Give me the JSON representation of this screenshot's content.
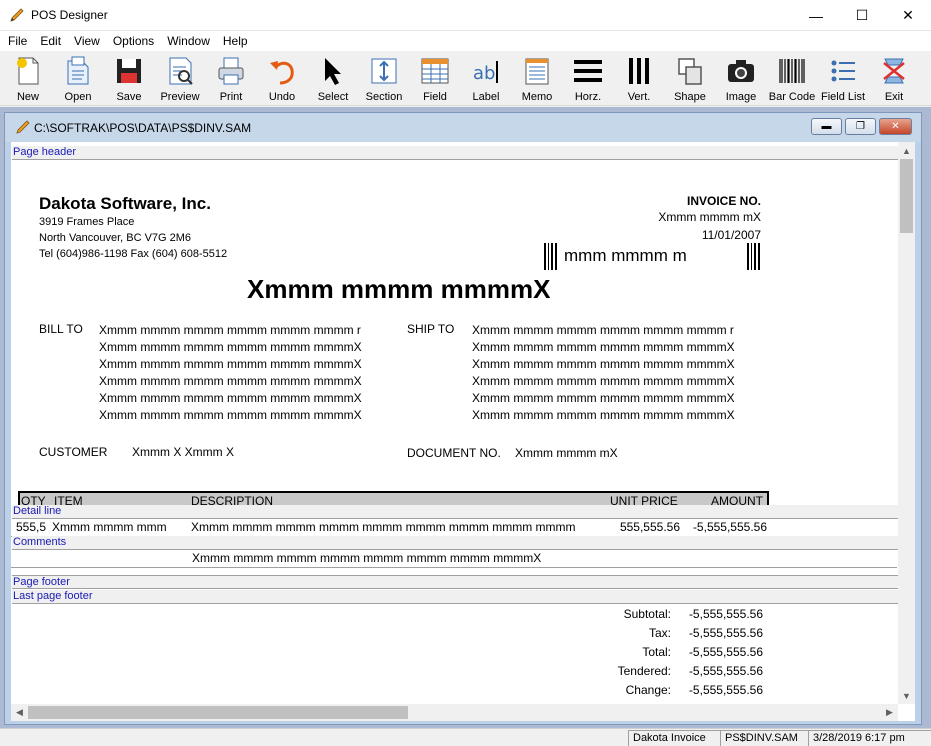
{
  "window": {
    "title": "POS Designer",
    "minimize": "—",
    "maximize": "☐",
    "close": "✕"
  },
  "menu": [
    "File",
    "Edit",
    "View",
    "Options",
    "Window",
    "Help"
  ],
  "toolbar": [
    {
      "label": "New",
      "icon": "new-document-icon"
    },
    {
      "label": "Open",
      "icon": "open-document-icon"
    },
    {
      "label": "Save",
      "icon": "floppy-disk-icon"
    },
    {
      "label": "Preview",
      "icon": "preview-icon"
    },
    {
      "label": "Print",
      "icon": "printer-icon"
    },
    {
      "label": "Undo",
      "icon": "undo-arrow-icon"
    },
    {
      "label": "Select",
      "icon": "pointer-arrow-icon"
    },
    {
      "label": "Section",
      "icon": "section-icon"
    },
    {
      "label": "Field",
      "icon": "field-grid-icon"
    },
    {
      "label": "Label",
      "icon": "label-text-icon"
    },
    {
      "label": "Memo",
      "icon": "memo-icon"
    },
    {
      "label": "Horz.",
      "icon": "horizontal-lines-icon"
    },
    {
      "label": "Vert.",
      "icon": "vertical-lines-icon"
    },
    {
      "label": "Shape",
      "icon": "shape-icon"
    },
    {
      "label": "Image",
      "icon": "camera-icon"
    },
    {
      "label": "Bar Code",
      "icon": "barcode-icon"
    },
    {
      "label": "Field List",
      "icon": "field-list-icon"
    },
    {
      "label": "Exit",
      "icon": "exit-icon"
    }
  ],
  "document": {
    "title": "C:\\SOFTRAK\\POS\\DATA\\PS$DINV.SAM",
    "bands": {
      "page_header": "Page header",
      "detail": "Detail line",
      "comments": "Comments",
      "page_footer": "Page footer",
      "last_page_footer": "Last page footer"
    },
    "company": {
      "name": "Dakota Software, Inc.",
      "address1": "3919 Frames Place",
      "address2": "North Vancouver, BC V7G 2M6",
      "phone": "Tel (604)986-1198   Fax (604) 608-5512"
    },
    "invoice_label": "INVOICE NO.",
    "invoice_no": "Xmmm mmmm mX",
    "invoice_date": "11/01/2007",
    "barcode_text": "mmm    mmmm     m",
    "big_title": "Xmmm mmmm mmmmX",
    "bill_to_label": "BILL TO",
    "ship_to_label": "SHIP TO",
    "bill_to_lines": [
      "Xmmm mmmm mmmm mmmm mmmm mmmm r",
      "Xmmm mmmm mmmm mmmm mmmm mmmmX",
      "Xmmm mmmm mmmm mmmm mmmm mmmmX",
      "Xmmm mmmm mmmm mmmm mmmm mmmmX",
      "Xmmm mmmm mmmm mmmm mmmm mmmmX",
      "Xmmm mmmm mmmm mmmm mmmm mmmmX"
    ],
    "ship_to_lines": [
      "Xmmm mmmm mmmm mmmm mmmm mmmm r",
      "Xmmm mmmm mmmm mmmm mmmm mmmmX",
      "Xmmm mmmm mmmm mmmm mmmm mmmmX",
      "Xmmm mmmm mmmm mmmm mmmm mmmmX",
      "Xmmm mmmm mmmm mmmm mmmm mmmmX",
      "Xmmm mmmm mmmm mmmm mmmm mmmmX"
    ],
    "customer_label": "CUSTOMER",
    "customer_value": "Xmmm X   Xmmm X",
    "docno_label": "DOCUMENT NO.",
    "docno_value": "Xmmm mmmm mX",
    "columns": {
      "qty": "QTY",
      "item": "ITEM",
      "description": "DESCRIPTION",
      "unit_price": "UNIT PRICE",
      "amount": "AMOUNT"
    },
    "detail_row": {
      "qty": "555,5",
      "item": "Xmmm mmmm mmm",
      "description": "Xmmm mmmm mmmm mmmm mmmm mmmm mmmm mmmm mmmm",
      "unit_price": "555,555.56",
      "amount": "-5,555,555.56"
    },
    "comment": "Xmmm mmmm mmmm mmmm mmmm mmmm mmmm mmmmX",
    "totals": [
      {
        "label": "Subtotal:",
        "value": "-5,555,555.56"
      },
      {
        "label": "Tax:",
        "value": "-5,555,555.56"
      },
      {
        "label": "Total:",
        "value": "-5,555,555.56"
      },
      {
        "label": "Tendered:",
        "value": "-5,555,555.56"
      },
      {
        "label": "Change:",
        "value": "-5,555,555.56"
      }
    ]
  },
  "status": {
    "report_name": "Dakota Invoice",
    "file_name": "PS$DINV.SAM",
    "datetime": "3/28/2019 6:17 pm"
  }
}
